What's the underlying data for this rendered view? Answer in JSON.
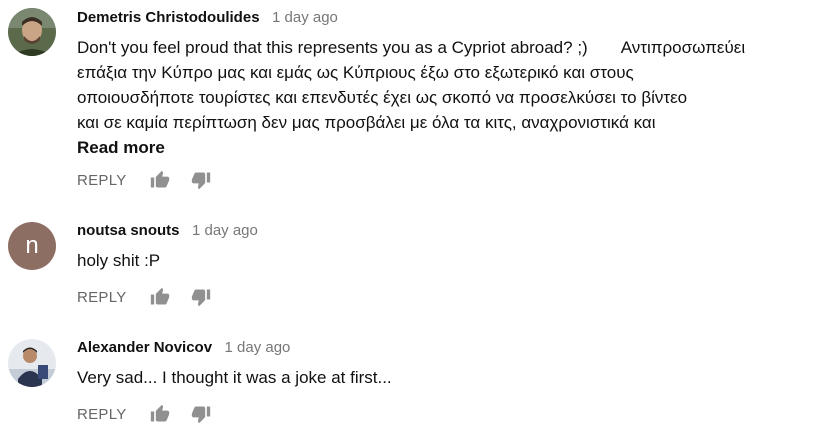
{
  "comments": [
    {
      "author": "Demetris Christodoulides",
      "time": "1 day ago",
      "text_lines": [
        "Don't you feel proud that this represents you as a Cypriot abroad? ;)       Αντιπροσωπεύει",
        "επάξια την Κύπρο μας και εμάς ως Κύπριους έξω στο εξωτερικό και στους",
        "οποιουσδήποτε τουρίστες και επενδυτές έχει ως σκοπό να προσελκύσει το βίντεο",
        "και σε καμία περίπτωση δεν μας προσβάλει με όλα τα κιτς, αναχρονιστικά και"
      ],
      "read_more": "Read more",
      "reply": "REPLY",
      "avatar": "photo"
    },
    {
      "author": "noutsa snouts",
      "time": "1 day ago",
      "text_lines": [
        "holy shit :P"
      ],
      "reply": "REPLY",
      "avatar_letter": "n",
      "avatar_color": "#8d6e63"
    },
    {
      "author": "Alexander Novicov",
      "time": "1 day ago",
      "text_lines": [
        "Very sad... I thought it was a joke at first..."
      ],
      "reply": "REPLY",
      "avatar": "photo"
    }
  ],
  "icons": {
    "like": "thumbs-up-icon",
    "dislike": "thumbs-down-icon"
  },
  "colors": {
    "author": "#111111",
    "timestamp": "#777777",
    "action": "#666666",
    "icon": "#909090"
  }
}
